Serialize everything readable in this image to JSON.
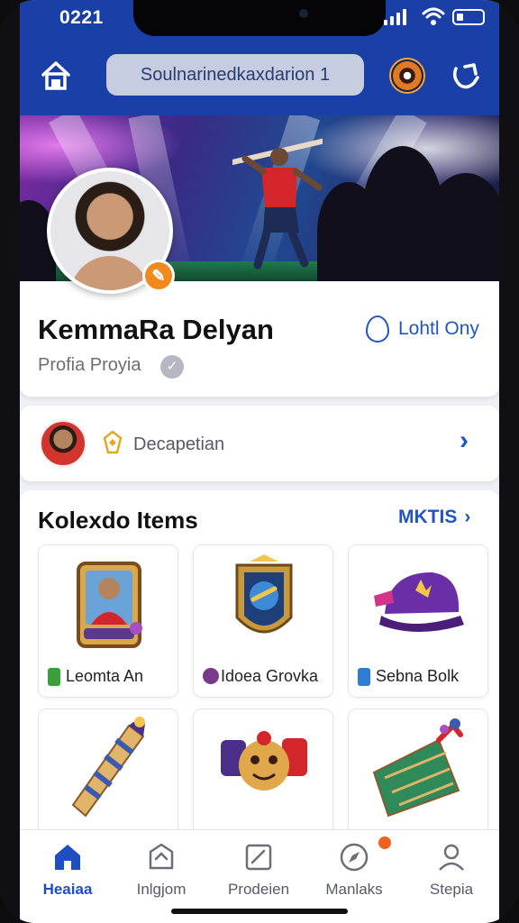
{
  "status": {
    "time": "0221"
  },
  "header": {
    "search_text": "Soulnarinedkaxdarion 1"
  },
  "profile": {
    "name": "KemmaRa Delyan",
    "subtitle": "Profia Proyia",
    "online_label": "Lohtl Ony"
  },
  "deposit": {
    "label": "Decapetian"
  },
  "collection": {
    "title": "Kolexdo Items",
    "more_label": "MKTIS",
    "items": [
      {
        "label": "Leomta An",
        "badge_color": "#3aa03a",
        "icon": "player-card-icon"
      },
      {
        "label": "Idoea Grovka",
        "badge_color": "#7a3a8a",
        "icon": "shield-badge-icon"
      },
      {
        "label": "Sebna Bolk",
        "badge_color": "#2c7ed6",
        "icon": "cap-icon"
      },
      {
        "label": "",
        "badge_color": "#3aa03a",
        "icon": "scarf-icon"
      },
      {
        "label": "",
        "badge_color": "#7a3a8a",
        "icon": "mascot-icon"
      },
      {
        "label": "",
        "badge_color": "#2c7ed6",
        "icon": "trophy-icon"
      }
    ]
  },
  "tabs": [
    {
      "label": "Heaiaa",
      "icon": "home-icon",
      "active": true
    },
    {
      "label": "Inlgjom",
      "icon": "tray-icon",
      "active": false
    },
    {
      "label": "Prodeien",
      "icon": "edit-icon",
      "active": false
    },
    {
      "label": "Manlaks",
      "icon": "compass-icon",
      "active": false
    },
    {
      "label": "Stepia",
      "icon": "profile-icon",
      "active": false
    }
  ],
  "colors": {
    "brand": "#1a3fa6",
    "accent": "#2255c4",
    "verify": "#f08a1e"
  }
}
